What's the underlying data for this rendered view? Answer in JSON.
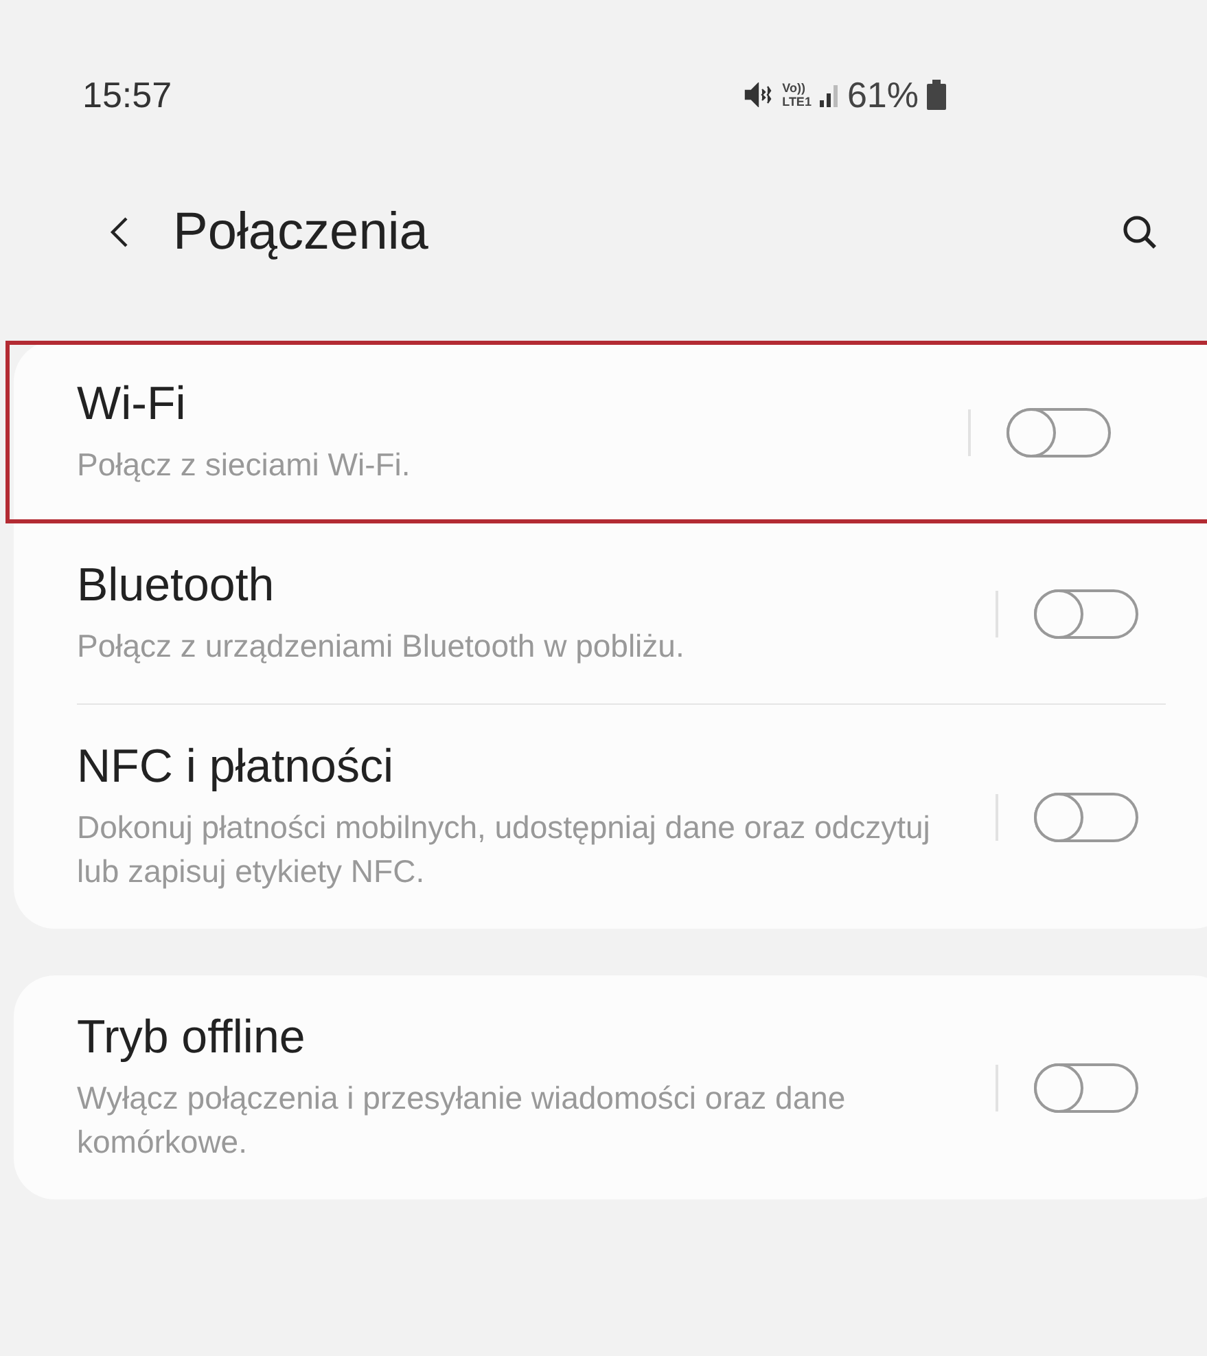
{
  "status_bar": {
    "time": "15:57",
    "network": [
      "Vo))",
      "LTE1"
    ],
    "battery": "61%"
  },
  "header": {
    "title": "Połączenia"
  },
  "groups": [
    {
      "items": [
        {
          "title": "Wi-Fi",
          "subtitle": "Połącz z sieciami Wi-Fi.",
          "on": false,
          "highlighted": true
        },
        {
          "title": "Bluetooth",
          "subtitle": "Połącz z urządzeniami Bluetooth w pobliżu.",
          "on": false,
          "highlighted": false
        },
        {
          "title": "NFC i płatności",
          "subtitle": "Dokonuj płatności mobilnych, udostępniaj dane oraz odczytuj lub zapisuj etykiety NFC.",
          "on": false,
          "highlighted": false
        }
      ]
    },
    {
      "items": [
        {
          "title": "Tryb offline",
          "subtitle": "Wyłącz połączenia i przesyłanie wiadomości oraz dane komórkowe.",
          "on": false,
          "highlighted": false
        }
      ]
    }
  ]
}
